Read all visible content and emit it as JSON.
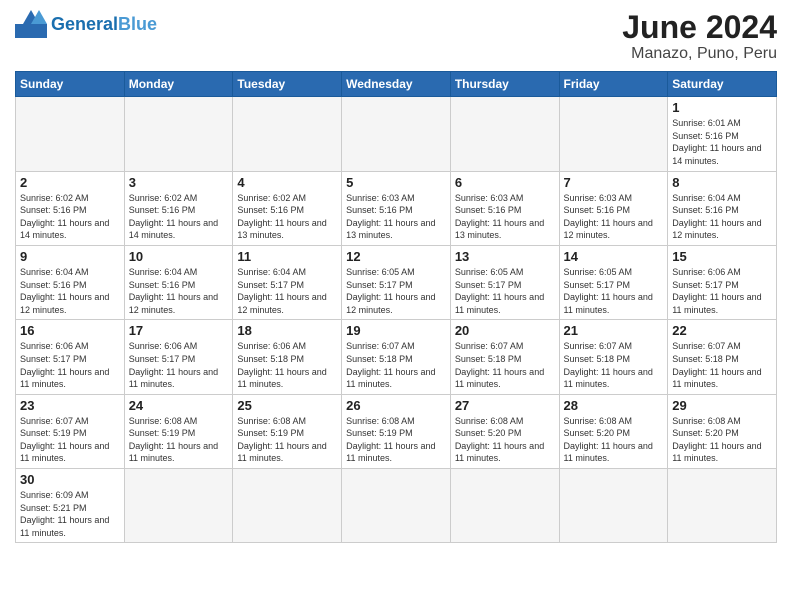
{
  "header": {
    "logo_general": "General",
    "logo_blue": "Blue",
    "title": "June 2024",
    "subtitle": "Manazo, Puno, Peru"
  },
  "weekdays": [
    "Sunday",
    "Monday",
    "Tuesday",
    "Wednesday",
    "Thursday",
    "Friday",
    "Saturday"
  ],
  "days": {
    "1": {
      "sunrise": "6:01 AM",
      "sunset": "5:16 PM",
      "daylight": "11 hours and 14 minutes."
    },
    "2": {
      "sunrise": "6:02 AM",
      "sunset": "5:16 PM",
      "daylight": "11 hours and 14 minutes."
    },
    "3": {
      "sunrise": "6:02 AM",
      "sunset": "5:16 PM",
      "daylight": "11 hours and 14 minutes."
    },
    "4": {
      "sunrise": "6:02 AM",
      "sunset": "5:16 PM",
      "daylight": "11 hours and 13 minutes."
    },
    "5": {
      "sunrise": "6:03 AM",
      "sunset": "5:16 PM",
      "daylight": "11 hours and 13 minutes."
    },
    "6": {
      "sunrise": "6:03 AM",
      "sunset": "5:16 PM",
      "daylight": "11 hours and 13 minutes."
    },
    "7": {
      "sunrise": "6:03 AM",
      "sunset": "5:16 PM",
      "daylight": "11 hours and 12 minutes."
    },
    "8": {
      "sunrise": "6:04 AM",
      "sunset": "5:16 PM",
      "daylight": "11 hours and 12 minutes."
    },
    "9": {
      "sunrise": "6:04 AM",
      "sunset": "5:16 PM",
      "daylight": "11 hours and 12 minutes."
    },
    "10": {
      "sunrise": "6:04 AM",
      "sunset": "5:16 PM",
      "daylight": "11 hours and 12 minutes."
    },
    "11": {
      "sunrise": "6:04 AM",
      "sunset": "5:17 PM",
      "daylight": "11 hours and 12 minutes."
    },
    "12": {
      "sunrise": "6:05 AM",
      "sunset": "5:17 PM",
      "daylight": "11 hours and 12 minutes."
    },
    "13": {
      "sunrise": "6:05 AM",
      "sunset": "5:17 PM",
      "daylight": "11 hours and 11 minutes."
    },
    "14": {
      "sunrise": "6:05 AM",
      "sunset": "5:17 PM",
      "daylight": "11 hours and 11 minutes."
    },
    "15": {
      "sunrise": "6:06 AM",
      "sunset": "5:17 PM",
      "daylight": "11 hours and 11 minutes."
    },
    "16": {
      "sunrise": "6:06 AM",
      "sunset": "5:17 PM",
      "daylight": "11 hours and 11 minutes."
    },
    "17": {
      "sunrise": "6:06 AM",
      "sunset": "5:17 PM",
      "daylight": "11 hours and 11 minutes."
    },
    "18": {
      "sunrise": "6:06 AM",
      "sunset": "5:18 PM",
      "daylight": "11 hours and 11 minutes."
    },
    "19": {
      "sunrise": "6:07 AM",
      "sunset": "5:18 PM",
      "daylight": "11 hours and 11 minutes."
    },
    "20": {
      "sunrise": "6:07 AM",
      "sunset": "5:18 PM",
      "daylight": "11 hours and 11 minutes."
    },
    "21": {
      "sunrise": "6:07 AM",
      "sunset": "5:18 PM",
      "daylight": "11 hours and 11 minutes."
    },
    "22": {
      "sunrise": "6:07 AM",
      "sunset": "5:18 PM",
      "daylight": "11 hours and 11 minutes."
    },
    "23": {
      "sunrise": "6:07 AM",
      "sunset": "5:19 PM",
      "daylight": "11 hours and 11 minutes."
    },
    "24": {
      "sunrise": "6:08 AM",
      "sunset": "5:19 PM",
      "daylight": "11 hours and 11 minutes."
    },
    "25": {
      "sunrise": "6:08 AM",
      "sunset": "5:19 PM",
      "daylight": "11 hours and 11 minutes."
    },
    "26": {
      "sunrise": "6:08 AM",
      "sunset": "5:19 PM",
      "daylight": "11 hours and 11 minutes."
    },
    "27": {
      "sunrise": "6:08 AM",
      "sunset": "5:20 PM",
      "daylight": "11 hours and 11 minutes."
    },
    "28": {
      "sunrise": "6:08 AM",
      "sunset": "5:20 PM",
      "daylight": "11 hours and 11 minutes."
    },
    "29": {
      "sunrise": "6:08 AM",
      "sunset": "5:20 PM",
      "daylight": "11 hours and 11 minutes."
    },
    "30": {
      "sunrise": "6:09 AM",
      "sunset": "5:21 PM",
      "daylight": "11 hours and 11 minutes."
    }
  },
  "labels": {
    "sunrise": "Sunrise:",
    "sunset": "Sunset:",
    "daylight": "Daylight:"
  }
}
